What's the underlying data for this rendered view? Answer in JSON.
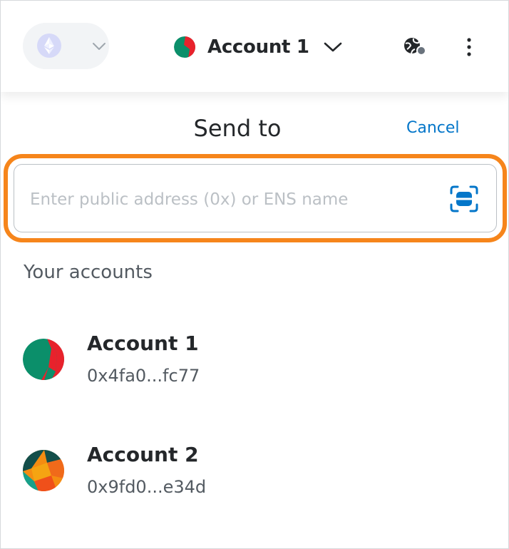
{
  "header": {
    "network_icon": "ethereum-icon",
    "account_name": "Account 1",
    "connection_icon": "globe-icon",
    "menu_icon": "kebab-menu-icon"
  },
  "send": {
    "title": "Send to",
    "cancel_label": "Cancel",
    "address_placeholder": "Enter public address (0x) or ENS name",
    "address_value": "",
    "scan_icon": "qr-scan-icon"
  },
  "accounts": {
    "title": "Your accounts",
    "items": [
      {
        "name": "Account 1",
        "address": "0x4fa0...fc77"
      },
      {
        "name": "Account 2",
        "address": "0x9fd0...e34d"
      }
    ]
  },
  "colors": {
    "highlight": "#f6851b",
    "link": "#0376c9",
    "text": "#24272a",
    "muted": "#535a61"
  }
}
